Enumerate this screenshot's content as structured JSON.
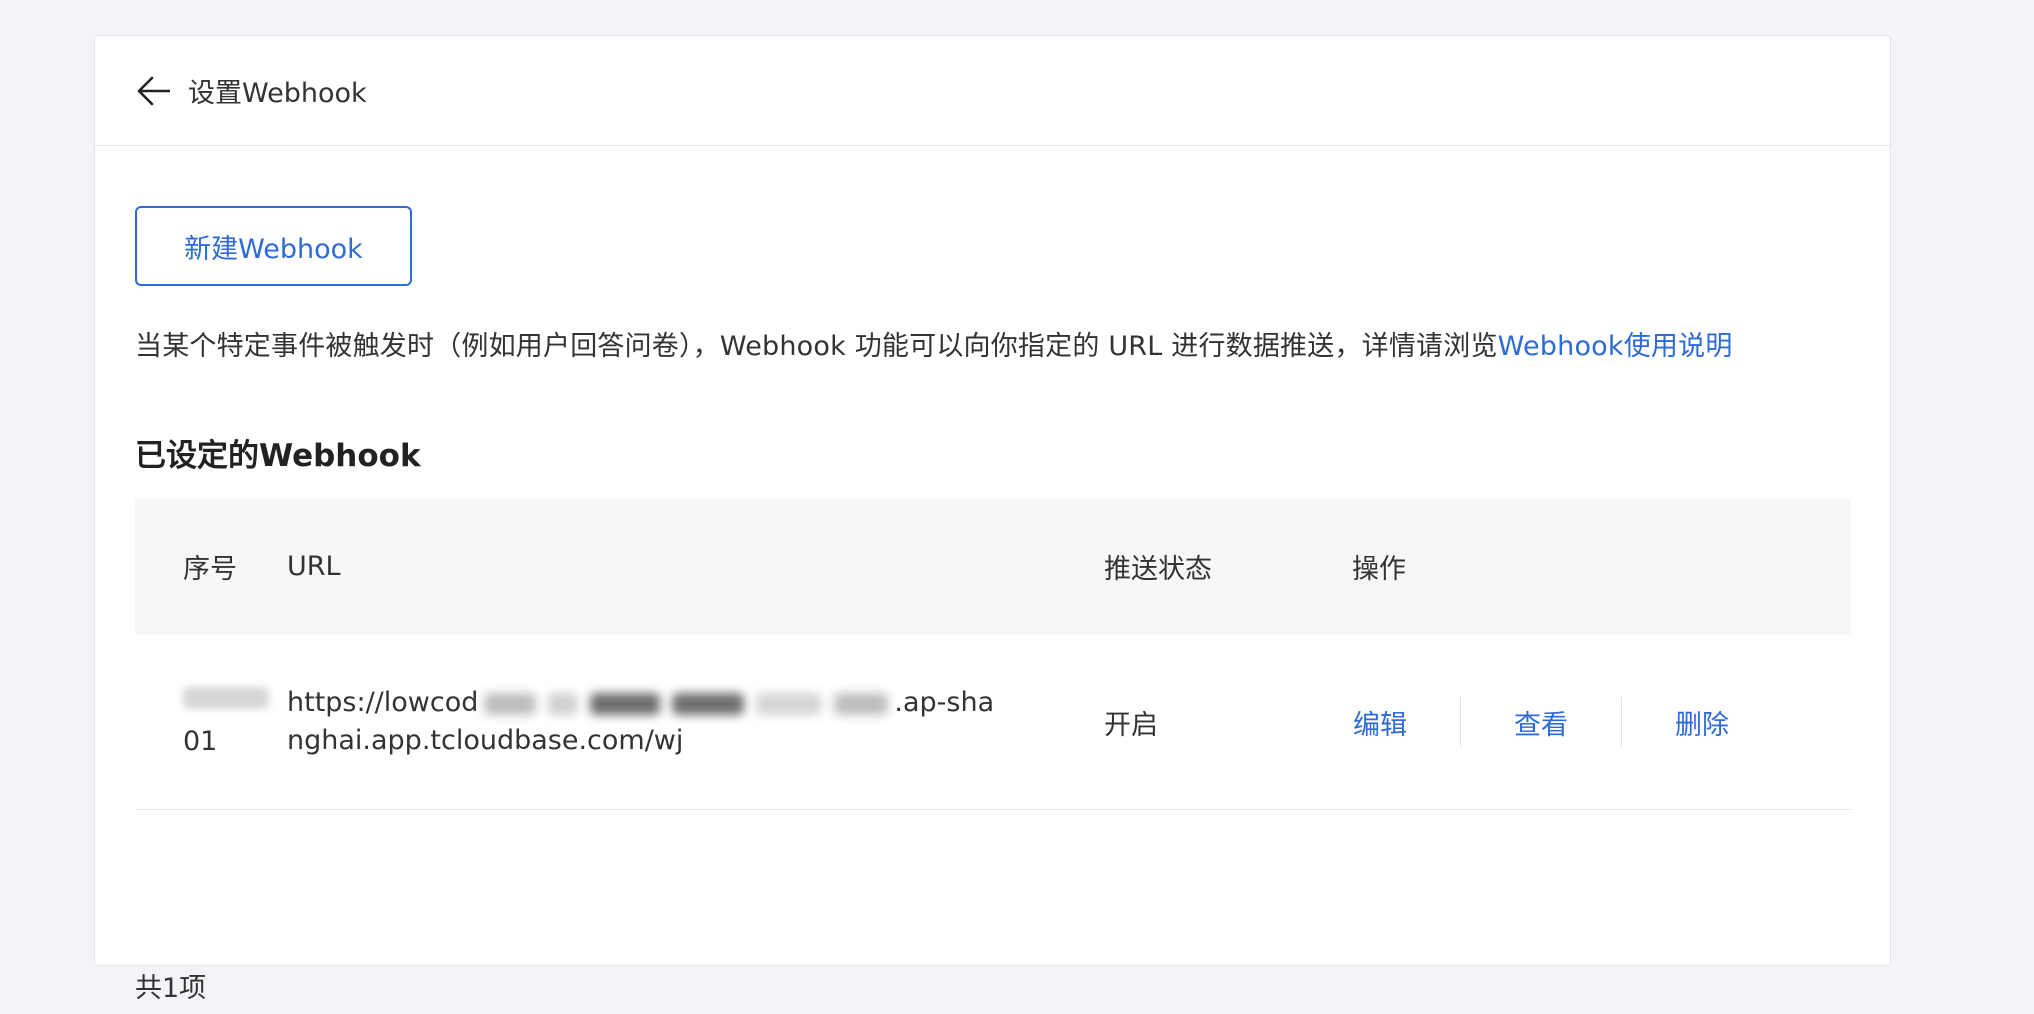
{
  "header": {
    "title": "设置Webhook"
  },
  "actions": {
    "new_label": "新建Webhook"
  },
  "description": {
    "text": "当某个特定事件被触发时（例如用户回答问卷），Webhook 功能可以向你指定的 URL 进行数据推送，详情请浏览",
    "link_label": "Webhook使用说明"
  },
  "section": {
    "title": "已设定的Webhook"
  },
  "table": {
    "columns": {
      "index": "序号",
      "url": "URL",
      "status": "推送状态",
      "ops": "操作"
    },
    "rows": [
      {
        "index_suffix": "01",
        "url_line1_prefix": "https://lowcod",
        "url_line1_suffix": ".ap-sha",
        "url_line2": "nghai.app.tcloudbase.com/wj",
        "status": "开启",
        "op_edit": "编辑",
        "op_view": "查看",
        "op_delete": "删除"
      }
    ]
  },
  "footer": {
    "count": "共1项"
  },
  "colors": {
    "accent": "#2e6bd8",
    "background": "#f3f4f7"
  }
}
